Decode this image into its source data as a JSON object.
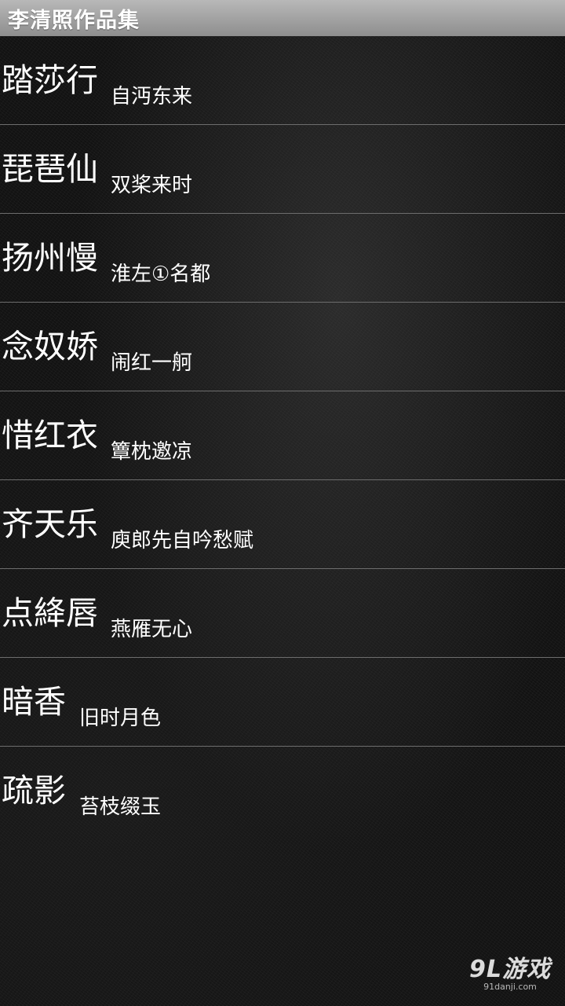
{
  "header": {
    "title": "李清照作品集"
  },
  "items": [
    {
      "title": "踏莎行",
      "subtitle": "自沔东来"
    },
    {
      "title": "琵琶仙",
      "subtitle": "双桨来时"
    },
    {
      "title": "扬州慢",
      "subtitle": "淮左①名都"
    },
    {
      "title": "念奴娇",
      "subtitle": "闹红一舸"
    },
    {
      "title": "惜红衣",
      "subtitle": "簟枕邀凉"
    },
    {
      "title": "齐天乐",
      "subtitle": "庾郎先自吟愁赋"
    },
    {
      "title": "点絳唇",
      "subtitle": "燕雁无心"
    },
    {
      "title": "暗香",
      "subtitle": "旧时月色"
    },
    {
      "title": "疏影",
      "subtitle": "苔枝缀玉"
    }
  ],
  "watermark": {
    "logo": "9L游戏",
    "url": "91danji.com"
  }
}
